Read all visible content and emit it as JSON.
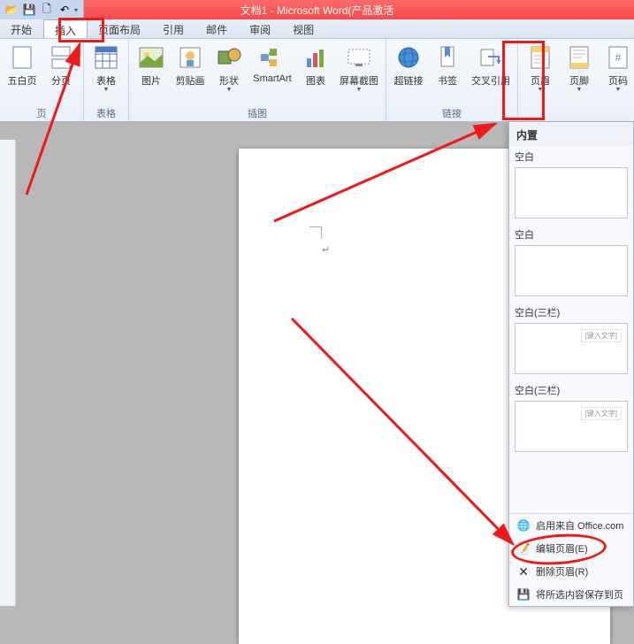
{
  "title": "文档1 - Microsoft Word(产品激活",
  "tabs": {
    "start": "开始",
    "insert": "插入",
    "layout": "页面布局",
    "references": "引用",
    "mail": "邮件",
    "review": "审阅",
    "view": "视图"
  },
  "ribbon": {
    "groups": {
      "pages": {
        "label": "页",
        "blank": "五白页",
        "break": "分页"
      },
      "tables": {
        "label": "表格",
        "table": "表格"
      },
      "illustrations": {
        "label": "插图",
        "picture": "图片",
        "clipart": "剪贴画",
        "shapes": "形状",
        "smartart": "SmartArt",
        "chart": "图表",
        "screenshot": "屏幕截图"
      },
      "links": {
        "label": "链接",
        "hyperlink": "超链接",
        "bookmark": "书签",
        "crossref": "交叉引用"
      },
      "headerfooter": {
        "header": "页眉",
        "footer": "页脚",
        "pagenum": "页码"
      }
    }
  },
  "dropdown": {
    "builtin": "内置",
    "templates": [
      {
        "name": "空白",
        "ph": ""
      },
      {
        "name": "空白",
        "ph": ""
      },
      {
        "name": "空白(三栏)",
        "ph": "[键入文字]"
      },
      {
        "name": "空白(三栏)",
        "ph": "[键入文字]"
      }
    ],
    "office": "启用来自 Office.com",
    "edit": "编辑页眉(E)",
    "remove": "删除页眉(R)",
    "save": "将所选内容保存到页"
  },
  "icons": {
    "folder": "📂",
    "save": "💾",
    "new": "🗋",
    "undo": "↶"
  }
}
